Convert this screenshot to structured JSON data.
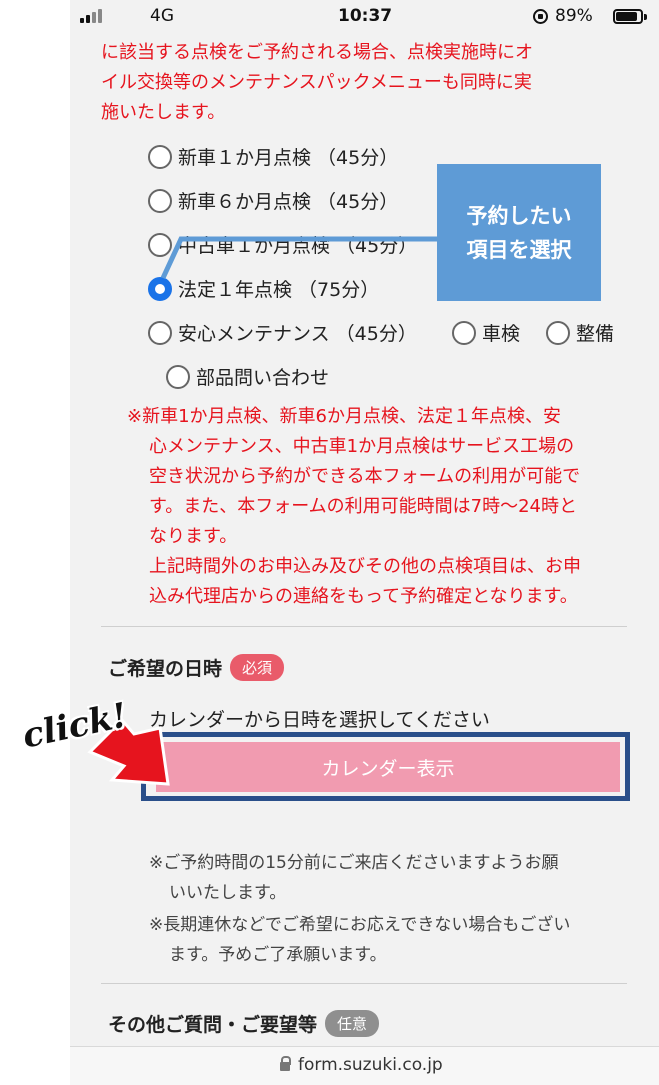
{
  "status_bar": {
    "network": "4G",
    "time": "10:37",
    "battery": "89%",
    "battery_level": 0.89
  },
  "notice_top": [
    "に該当する点検をご予約される場合、点検実施時にオ",
    "イル交換等のメンテナンスパックメニューも同時に実",
    "施いたします。"
  ],
  "inspection_options": [
    {
      "label": "新車１か月点検 （45分）",
      "checked": false
    },
    {
      "label": "新車６か月点検 （45分）",
      "checked": false
    },
    {
      "label": "中古車１か月点検 （45分）",
      "checked": false
    },
    {
      "label": "法定１年点検 （75分）",
      "checked": true
    },
    {
      "label": "安心メンテナンス （45分）",
      "checked": false
    },
    {
      "label": "車検",
      "checked": false
    },
    {
      "label": "整備",
      "checked": false
    },
    {
      "label": "部品問い合わせ",
      "checked": false
    }
  ],
  "notice_mid": [
    "※新車1か月点検、新車6か月点検、法定１年点検、安",
    "心メンテナンス、中古車1か月点検はサービス工場の",
    "空き状況から予約ができる本フォームの利用が可能で",
    "す。また、本フォームの利用可能時間は7時〜24時と",
    "なります。",
    "上記時間外のお申込み及びその他の点検項目は、お申",
    "込み代理店からの連絡をもって予約確定となります。"
  ],
  "datetime_section": {
    "title": "ご希望の日時",
    "badge": "必須",
    "hint": "カレンダーから日時を選択してください",
    "button_label": "カレンダー表示"
  },
  "notice_low": [
    {
      "lines": [
        "※ご予約時間の15分前にご来店くださいますようお願",
        "いいたします。"
      ]
    },
    {
      "lines": [
        "※長期連休などでご希望にお応えできない場合もござい",
        "ます。予めご了承願います。"
      ]
    }
  ],
  "other_section": {
    "title": "その他ご質問・ご要望等",
    "badge": "任意"
  },
  "url": "form.suzuki.co.jp",
  "annotations": {
    "callout_line1": "予約したい",
    "callout_line2": "項目を選択",
    "click_label": "click!",
    "callout_color": "#5e9bd6",
    "arrow_color": "#e6141e"
  }
}
